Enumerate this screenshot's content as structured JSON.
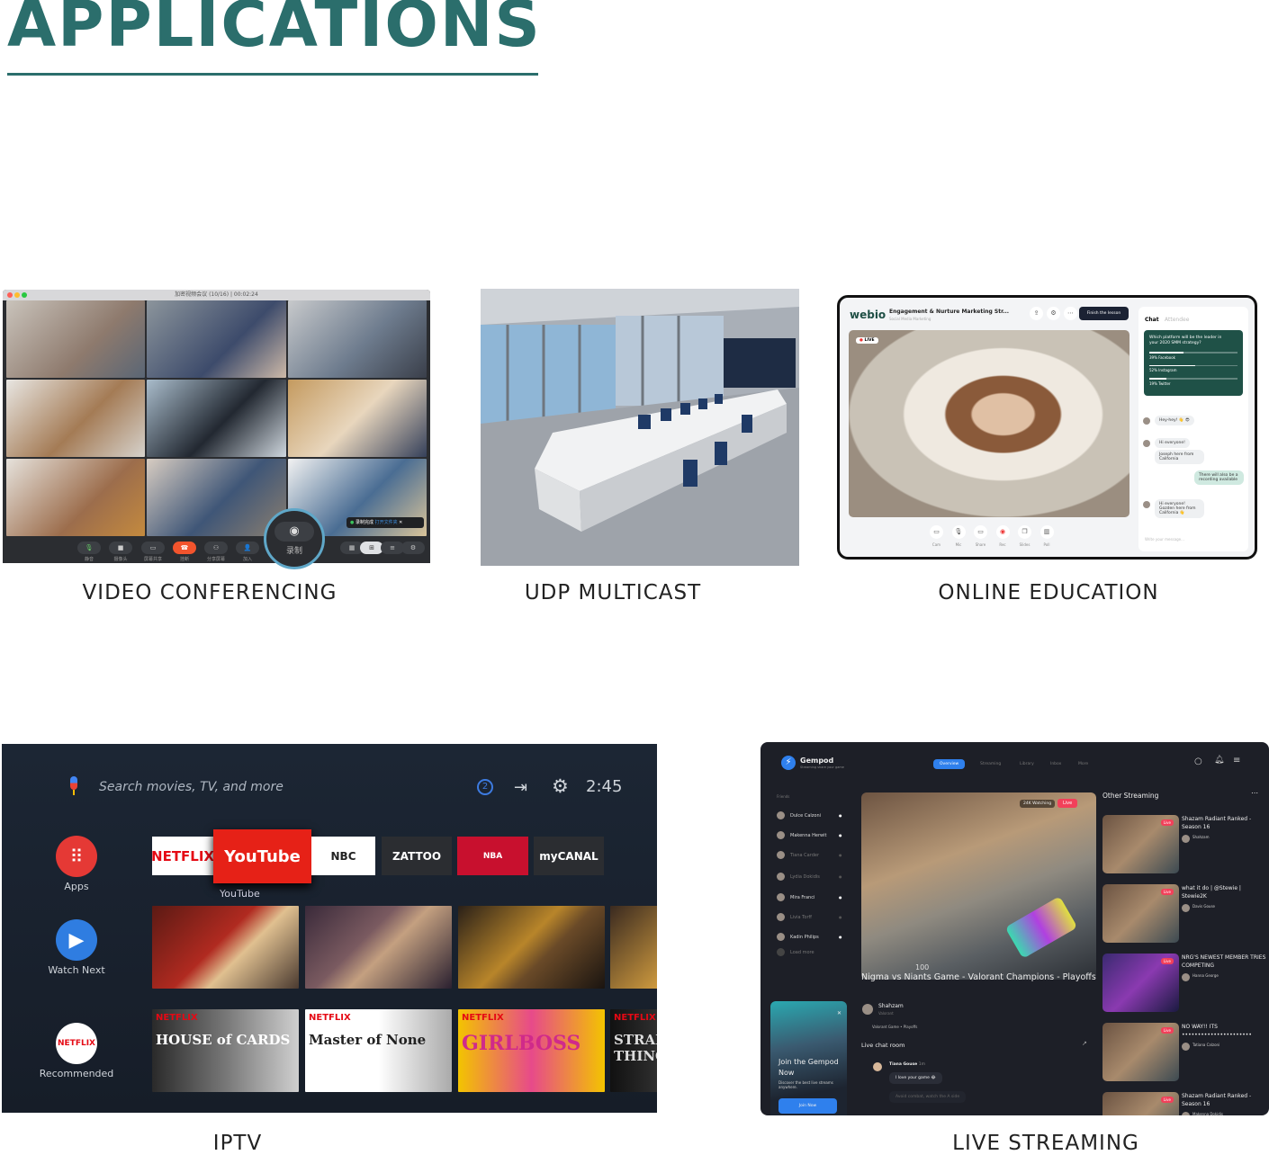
{
  "heading": "APPLICATIONS",
  "captions": {
    "video_conferencing": "VIDEO CONFERENCING",
    "udp_multicast": "UDP MULTICAST",
    "online_education": "ONLINE EDUCATION",
    "iptv": "IPTV",
    "live_streaming": "LIVE STREAMING"
  },
  "video_conf": {
    "window_title": "加密视频会议 (10/16) | 00:02:24",
    "toolbar": [
      "静音",
      "摄像头",
      "屏幕共享",
      "挂断",
      "分享屏幕",
      "加入",
      "录制",
      "演讲",
      "视图",
      "更多",
      "设置"
    ],
    "record_label": "录制",
    "toast": "录制完成",
    "toast_link": "打开文件夹"
  },
  "online_edu": {
    "logo": "webio",
    "title": "Engagement & Nurture Marketing Str...",
    "subtitle": "Social Media Marketing",
    "finish_button": "Finish the lesson",
    "live": "LIVE",
    "tabs": [
      "Chat",
      "Attendee"
    ],
    "poll": {
      "question": "Which platform will be the leader in your 2020 SMM strategy?",
      "options": [
        {
          "label": "39% Facebook",
          "pct": 39
        },
        {
          "label": "52% Instagram",
          "pct": 52
        },
        {
          "label": "19% Twitter",
          "pct": 19
        }
      ]
    },
    "messages": [
      {
        "text": "Hey-hey! 👋 😎",
        "mine": false
      },
      {
        "text": "Hi everyone!",
        "mine": false
      },
      {
        "text": "Joseph here from California",
        "mine": false
      },
      {
        "text": "There will also be a recording available",
        "mine": true
      },
      {
        "text": "Hi everyone! Gozden here from California 👋",
        "mine": false
      }
    ],
    "input_placeholder": "Write your message...",
    "controls": [
      "Cam",
      "Mic",
      "Share",
      "Rec",
      "Slides",
      "Poll"
    ]
  },
  "iptv": {
    "search_placeholder": "Search movies, TV, and more",
    "notification_count": "2",
    "time": "2:45",
    "side": [
      {
        "label": "Apps",
        "color": "#e53935"
      },
      {
        "label": "Watch Next",
        "color": "#2f7de1"
      },
      {
        "label": "Recommended",
        "color": "#ffffff"
      }
    ],
    "netflix_badge": "NETFLIX",
    "apps": [
      "NETFLIX",
      "YouTube",
      "NBC",
      "ZATTOO",
      "NBA",
      "myCANAL"
    ],
    "focused_label": "YouTube",
    "posters_row3": [
      {
        "badge": "NETFLIX",
        "title": "HOUSE of CARDS"
      },
      {
        "badge": "NETFLIX",
        "title": "Master of None"
      },
      {
        "badge": "NETFLIX",
        "title": "GIRLBOSS"
      },
      {
        "badge": "NETFLIX",
        "title": "STRANGER THINGS"
      }
    ]
  },
  "stream": {
    "logo": "Gempod",
    "tagline": "Streaming share your game",
    "tabs": [
      "Overview",
      "Streaming",
      "Library",
      "Inbox",
      "More"
    ],
    "friends_header": "Friends",
    "friends": [
      {
        "name": "Dulce Calzoni",
        "online": true
      },
      {
        "name": "Makenna Herwit",
        "online": true
      },
      {
        "name": "Tiana Carder",
        "online": false
      },
      {
        "name": "Lydia Dokidis",
        "online": false
      },
      {
        "name": "Mira Franci",
        "online": true
      },
      {
        "name": "Livia Torff",
        "online": false
      },
      {
        "name": "Kadin Philips",
        "online": true
      }
    ],
    "load_more": "Load more",
    "watching": "24K Watching",
    "live": "Live",
    "hud_health": "100",
    "title": "Nigma vs Niants Game - Valorant Champions - Playoffs",
    "streamer": "Shahzam",
    "streamer_game": "Valorant",
    "tags": [
      "Valorant Game",
      "Playoffs"
    ],
    "chat_header": "Live chat room",
    "chat": {
      "user": "Tiana Gouse",
      "time": "1m",
      "messages": [
        "I love your game 😂",
        "Avoid combat, watch the A side"
      ]
    },
    "promo": {
      "title": "Join the Gempod Now",
      "text": "Discover the best live streams anywhere.",
      "button": "Join Now"
    },
    "other_header": "Other Streaming",
    "others": [
      {
        "title": "Shazam Radiant Ranked - Season 16",
        "user": "Shahzam"
      },
      {
        "title": "what it do | @Stewie | Stewie2K",
        "user": "Davis Gouse"
      },
      {
        "title": "NRG'S NEWEST MEMBER TRIES COMPETING",
        "user": "Hanna George"
      },
      {
        "title": "NO WAY!! ITS ••••••••••••••••••••••",
        "user": "Tatiana Calzoni"
      },
      {
        "title": "Shazam Radiant Ranked - Season 16",
        "user": "Makenna Dokidis"
      }
    ]
  }
}
